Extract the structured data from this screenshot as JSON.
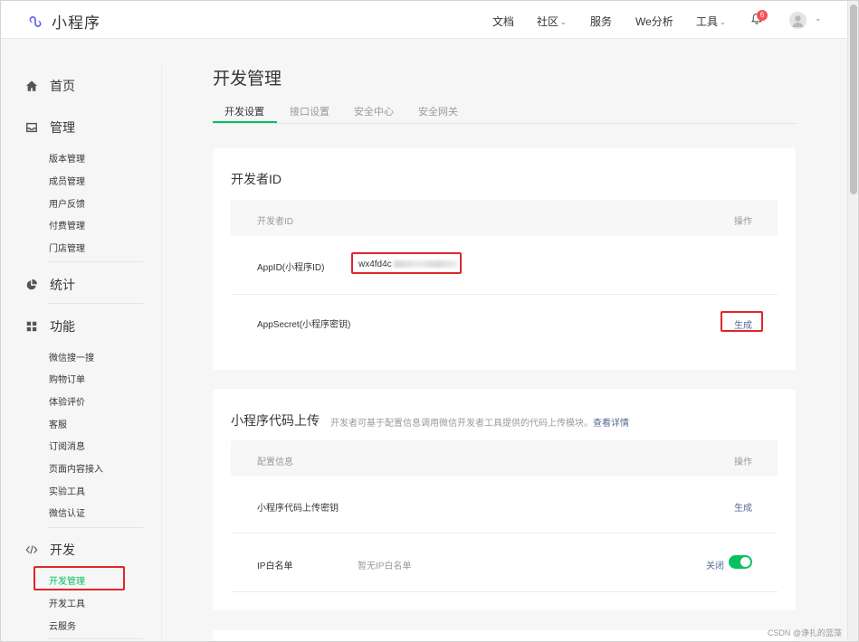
{
  "brand": {
    "name": "小程序",
    "accent": "#07c160",
    "link": "#576b95",
    "alert": "#e0262a"
  },
  "topnav": {
    "items": [
      {
        "label": "文档",
        "caret": false
      },
      {
        "label": "社区",
        "caret": true
      },
      {
        "label": "服务",
        "caret": false
      },
      {
        "label": "We分析",
        "caret": false
      },
      {
        "label": "工具",
        "caret": true
      }
    ],
    "notification_count": "6"
  },
  "sidebar": {
    "home": "首页",
    "manage": {
      "label": "管理",
      "items": [
        "版本管理",
        "成员管理",
        "用户反馈",
        "付费管理",
        "门店管理"
      ]
    },
    "stats": "统计",
    "features": {
      "label": "功能",
      "items": [
        "微信搜一搜",
        "购物订单",
        "体验评价",
        "客服",
        "订阅消息",
        "页面内容接入",
        "实验工具",
        "微信认证"
      ]
    },
    "develop": {
      "label": "开发",
      "items": [
        "开发管理",
        "开发工具",
        "云服务"
      ],
      "active_index": 0
    }
  },
  "main": {
    "title": "开发管理",
    "tabs": [
      {
        "label": "开发设置",
        "active": true
      },
      {
        "label": "接口设置",
        "active": false
      },
      {
        "label": "安全中心",
        "active": false
      },
      {
        "label": "安全网关",
        "active": false
      }
    ],
    "developer_id": {
      "title": "开发者ID",
      "col_left": "开发者ID",
      "col_right": "操作",
      "appid_label": "AppID(小程序ID)",
      "appid_value": "wx4fd4c",
      "secret_label": "AppSecret(小程序密钥)",
      "secret_action": "生成"
    },
    "upload": {
      "title": "小程序代码上传",
      "desc": "开发者可基于配置信息调用微信开发者工具提供的代码上传模块。",
      "desc_link": "查看详情",
      "col_left": "配置信息",
      "col_right": "操作",
      "key_label": "小程序代码上传密钥",
      "key_action": "生成",
      "ip_label": "IP白名单",
      "ip_hint": "暂无IP白名单",
      "ip_toggle_label": "关闭",
      "ip_toggle_on": true
    }
  },
  "footer": {
    "credit": "CSDN @诤扎的蓝藻"
  }
}
